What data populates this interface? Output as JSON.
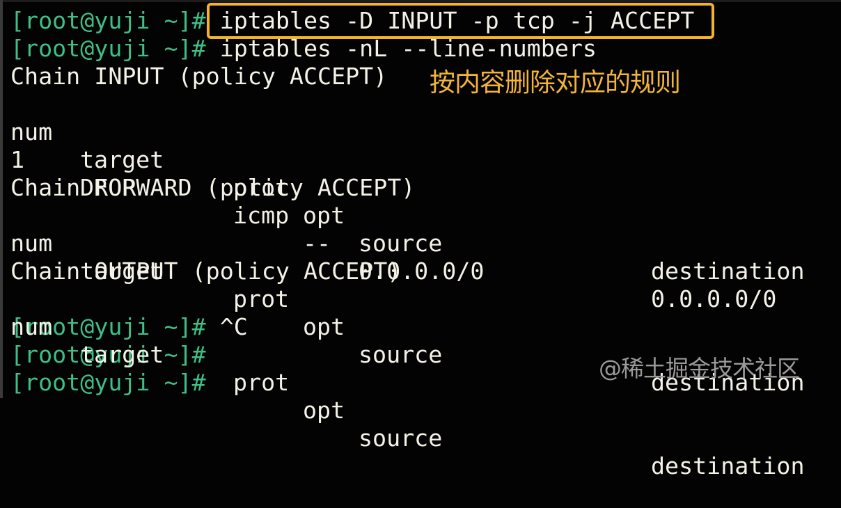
{
  "terminal": {
    "prompt": "[root@yuji ~]#",
    "lines": [
      {
        "type": "prompt",
        "command": "iptables -D INPUT -p tcp -j ACCEPT",
        "highlighted": true
      },
      {
        "type": "prompt",
        "command": "iptables -nL --line-numbers"
      },
      {
        "type": "output",
        "text": "Chain INPUT (policy ACCEPT)"
      },
      {
        "type": "output",
        "cols": [
          "num",
          "target",
          "prot",
          "opt",
          "source",
          "destination"
        ]
      },
      {
        "type": "output",
        "cols": [
          "1",
          "DROP",
          "icmp",
          "--",
          "0.0.0.0/0",
          "0.0.0.0/0"
        ]
      },
      {
        "type": "blank"
      },
      {
        "type": "output",
        "text": "Chain FORWARD (policy ACCEPT)"
      },
      {
        "type": "output",
        "cols": [
          "num",
          "target",
          "prot",
          "opt",
          "source",
          "destination"
        ]
      },
      {
        "type": "blank"
      },
      {
        "type": "output",
        "text": "Chain OUTPUT (policy ACCEPT)"
      },
      {
        "type": "output",
        "cols": [
          "num",
          "target",
          "prot",
          "opt",
          "source",
          "destination"
        ]
      },
      {
        "type": "prompt",
        "command": "^C"
      },
      {
        "type": "prompt",
        "command": ""
      },
      {
        "type": "prompt",
        "command": ""
      }
    ]
  },
  "annotation": "按内容删除对应的规则",
  "watermark": "@稀土掘金技术社区",
  "colors": {
    "background": "#030303",
    "prompt": "#3fbf86",
    "text": "#f4f1e6",
    "highlight_border": "#f4b425",
    "annotation": "#f3b43a",
    "watermark": "#9a9a9a"
  }
}
